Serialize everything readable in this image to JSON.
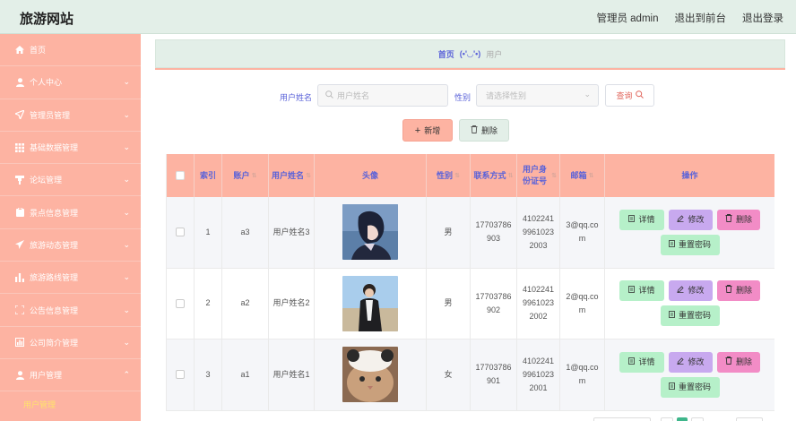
{
  "header": {
    "title": "旅游网站",
    "user_label": "管理员 admin",
    "front_link": "退出到前台",
    "logout_link": "退出登录"
  },
  "sidebar": {
    "items": [
      {
        "label": "首页",
        "icon": "home-icon",
        "chevron": false
      },
      {
        "label": "个人中心",
        "icon": "user-icon",
        "chevron": true
      },
      {
        "label": "管理员管理",
        "icon": "send-icon",
        "chevron": true
      },
      {
        "label": "基础数据管理",
        "icon": "grid-icon",
        "chevron": true
      },
      {
        "label": "论坛管理",
        "icon": "forum-icon",
        "chevron": true
      },
      {
        "label": "景点信息管理",
        "icon": "clipboard-icon",
        "chevron": true
      },
      {
        "label": "旅游动态管理",
        "icon": "plane-icon",
        "chevron": true
      },
      {
        "label": "旅游路线管理",
        "icon": "bar-chart-icon",
        "chevron": true
      },
      {
        "label": "公告信息管理",
        "icon": "frame-icon",
        "chevron": true
      },
      {
        "label": "公司简介管理",
        "icon": "chart-box-icon",
        "chevron": true
      },
      {
        "label": "用户管理",
        "icon": "user-icon",
        "chevron": true,
        "open": true
      }
    ],
    "submenu": [
      {
        "label": "用户管理"
      }
    ]
  },
  "breadcrumb": {
    "home": "首页",
    "separator": "(•'◡'•)",
    "current": "用户"
  },
  "search": {
    "name_label": "用户姓名",
    "name_placeholder": "用户姓名",
    "gender_label": "性别",
    "gender_placeholder": "请选择性别",
    "query_button": "查询"
  },
  "actions": {
    "add_button": "新增",
    "delete_button": "删除"
  },
  "table": {
    "columns": [
      "索引",
      "账户",
      "用户姓名",
      "头像",
      "性别",
      "联系方式",
      "用户身份证号",
      "邮箱",
      "操作"
    ],
    "rows": [
      {
        "index": "1",
        "account": "a3",
        "name": "用户姓名3",
        "gender": "男",
        "phone": "17703786903",
        "idcard": "410224199610232003",
        "email": "3@qq.com"
      },
      {
        "index": "2",
        "account": "a2",
        "name": "用户姓名2",
        "gender": "男",
        "phone": "17703786902",
        "idcard": "410224199610232002",
        "email": "2@qq.com"
      },
      {
        "index": "3",
        "account": "a1",
        "name": "用户姓名1",
        "gender": "女",
        "phone": "17703786901",
        "idcard": "410224199610232001",
        "email": "1@qq.com"
      }
    ],
    "row_buttons": {
      "detail": "详情",
      "edit": "修改",
      "delete": "删除",
      "reset": "重置密码"
    }
  },
  "colors": {
    "sidebar_bg": "#fdb3a2",
    "header_bg": "#e3efe8",
    "accent_text": "#5a62d9",
    "submenu_active": "#ffe36b"
  }
}
